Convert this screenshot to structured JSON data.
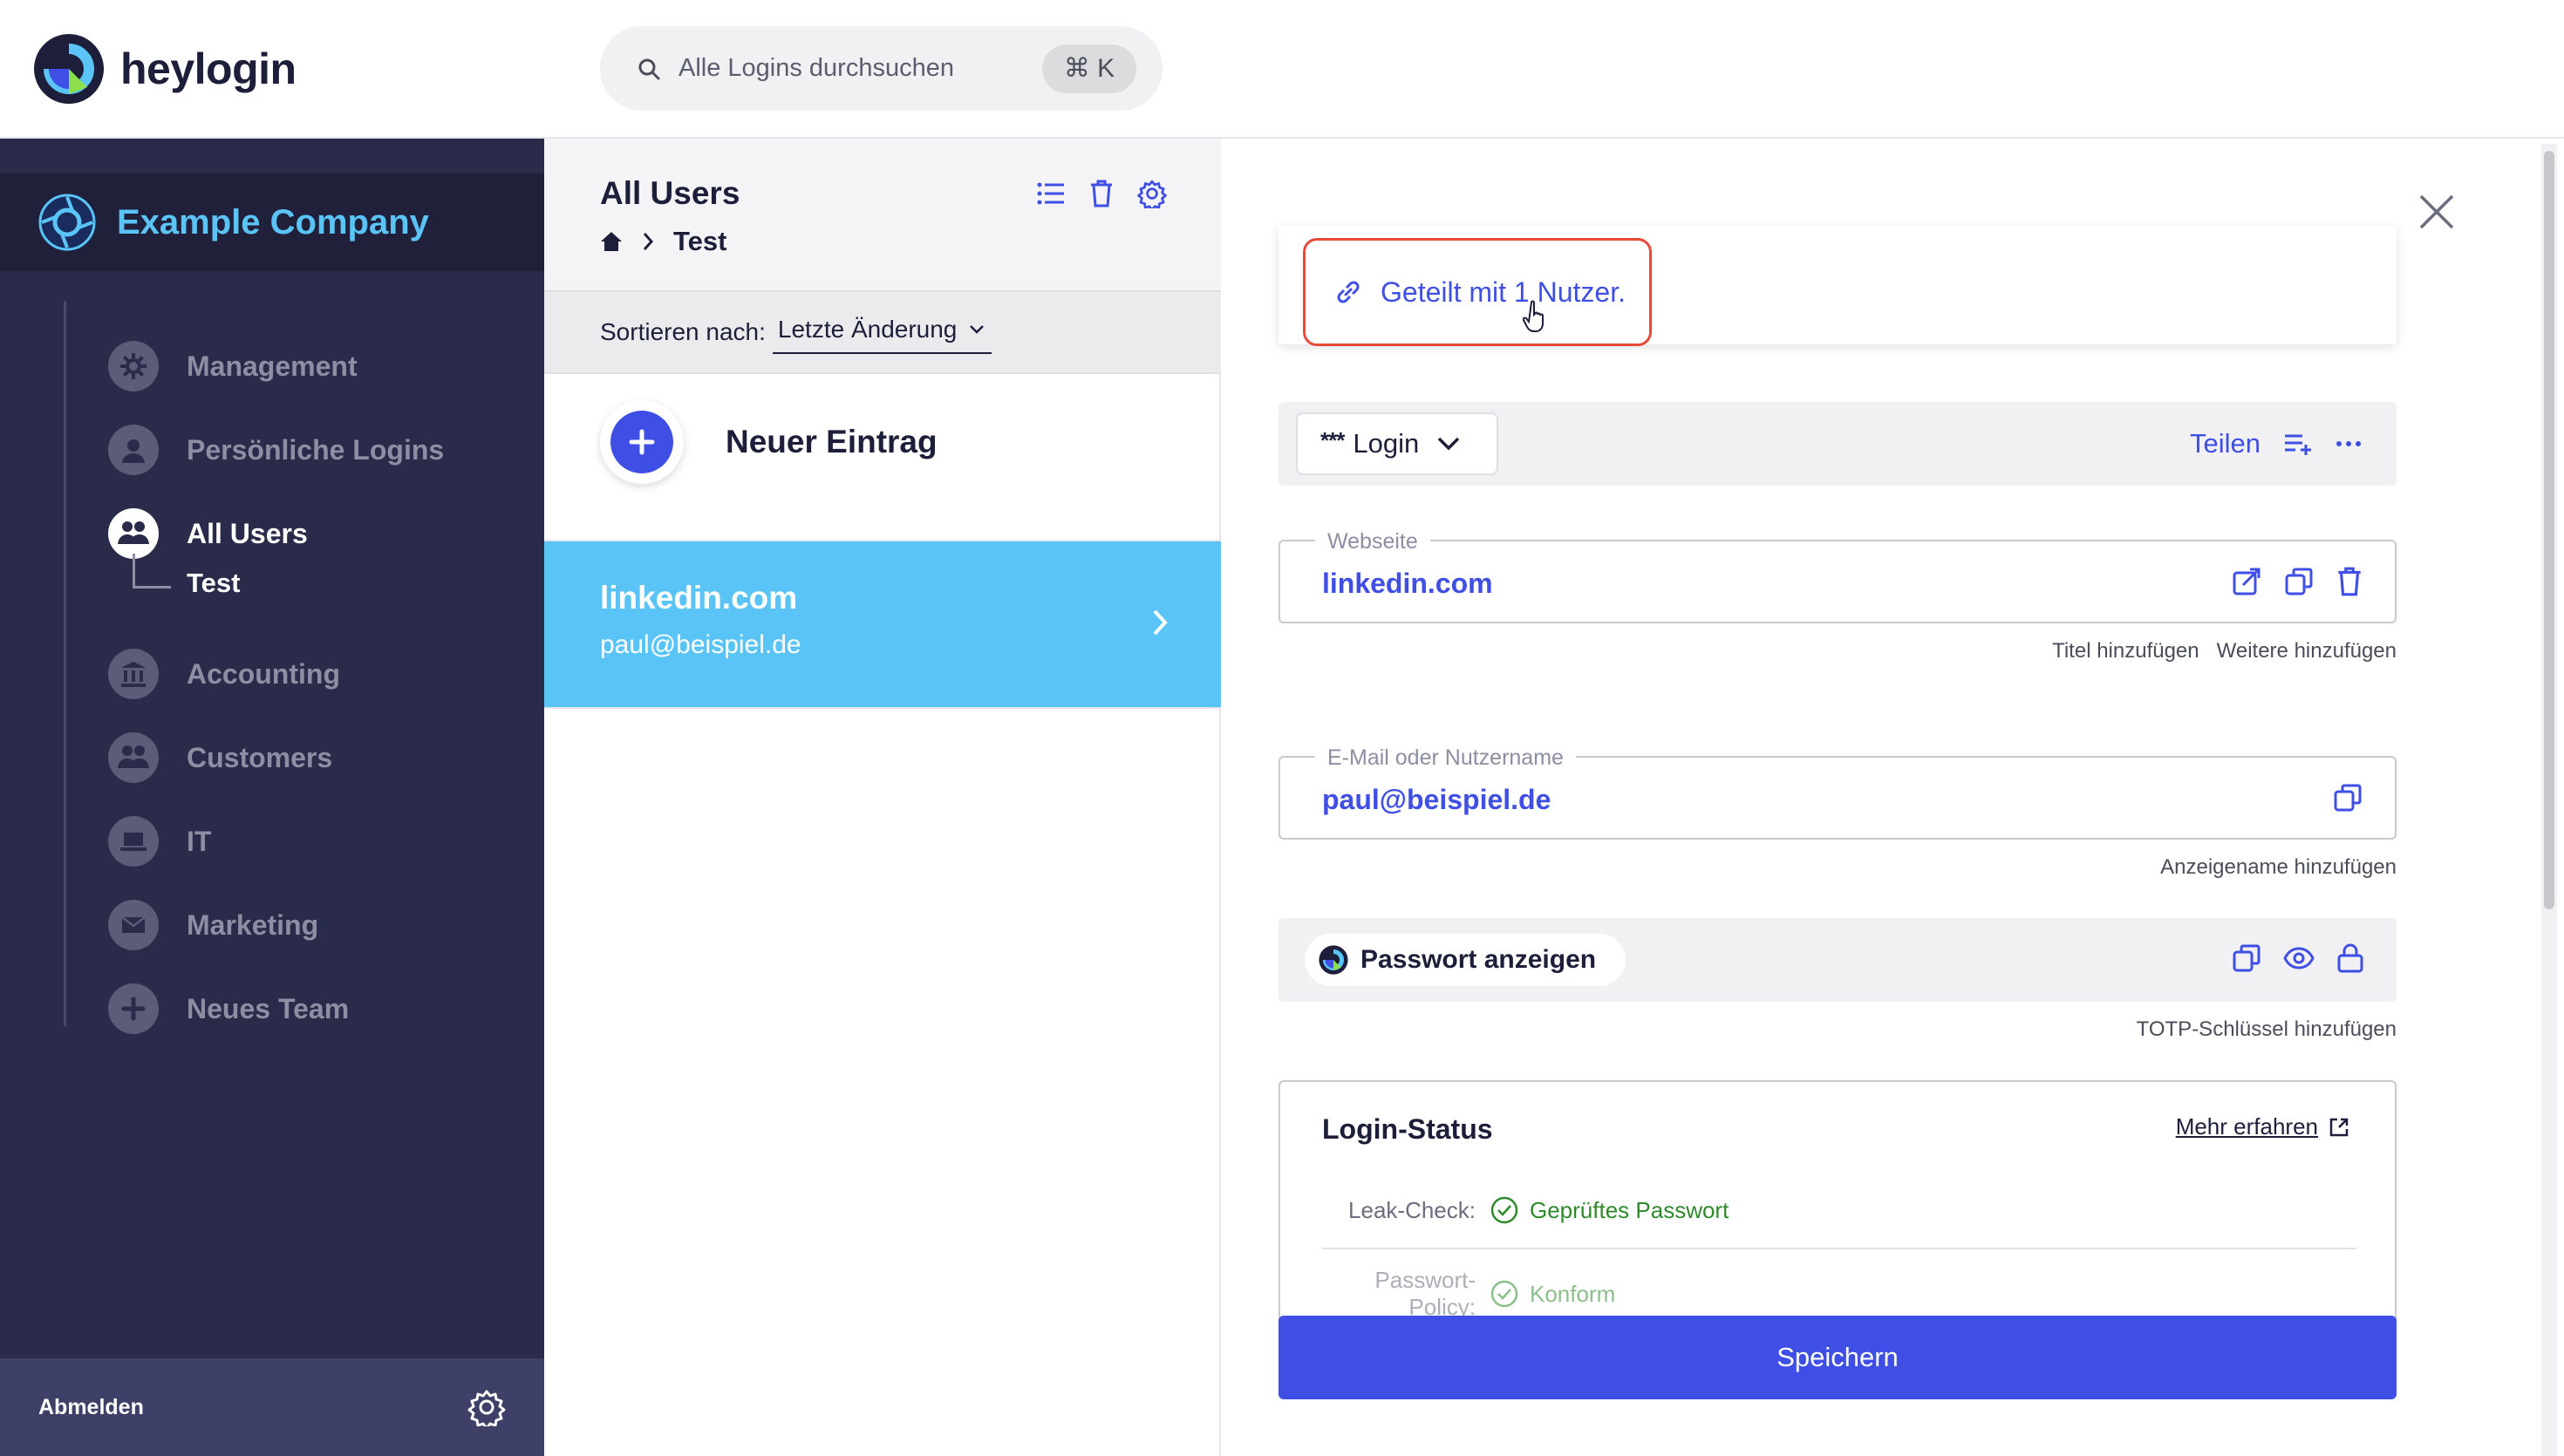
{
  "app": {
    "brand": "heylogin",
    "accent": "#3f4fe6",
    "highlight": "#5bc4f7",
    "sidebar_bg": "#2a2a4a"
  },
  "search": {
    "placeholder": "Alle Logins durchsuchen",
    "shortcut": "⌘ K"
  },
  "sidebar": {
    "company": "Example Company",
    "items": [
      {
        "label": "Management",
        "icon": "gear-icon"
      },
      {
        "label": "Persönliche Logins",
        "icon": "person-icon"
      },
      {
        "label": "All Users",
        "icon": "group-icon",
        "active": true
      },
      {
        "label": "Accounting",
        "icon": "bank-icon"
      },
      {
        "label": "Customers",
        "icon": "group-icon"
      },
      {
        "label": "IT",
        "icon": "laptop-icon"
      },
      {
        "label": "Marketing",
        "icon": "envelope-icon"
      },
      {
        "label": "Neues Team",
        "icon": "plus-icon"
      }
    ],
    "subitem": "Test",
    "logout": "Abmelden"
  },
  "list": {
    "title": "All Users",
    "breadcrumb": "Test",
    "sort_label": "Sortieren nach:",
    "sort_value": "Letzte Änderung",
    "new_entry": "Neuer Eintrag",
    "entries": [
      {
        "title": "linkedin.com",
        "subtitle": "paul@beispiel.de",
        "selected": true
      }
    ]
  },
  "detail": {
    "shared_text": "Geteilt mit 1 Nutzer.",
    "type_label": "Login",
    "type_dots": "***",
    "share_label": "Teilen",
    "website": {
      "legend": "Webseite",
      "value": "linkedin.com"
    },
    "website_hints": [
      "Titel hinzufügen",
      "Weitere hinzufügen"
    ],
    "username": {
      "legend": "E-Mail oder Nutzername",
      "value": "paul@beispiel.de"
    },
    "username_hint": "Anzeigename hinzufügen",
    "password_label": "Passwort anzeigen",
    "password_hint": "TOTP-Schlüssel hinzufügen",
    "status": {
      "title": "Login-Status",
      "more": "Mehr erfahren",
      "rows": [
        {
          "key": "Leak-Check:",
          "value": "Geprüftes Passwort"
        },
        {
          "key": "Passwort-Policy:",
          "value": "Konform"
        }
      ]
    },
    "save_label": "Speichern"
  }
}
